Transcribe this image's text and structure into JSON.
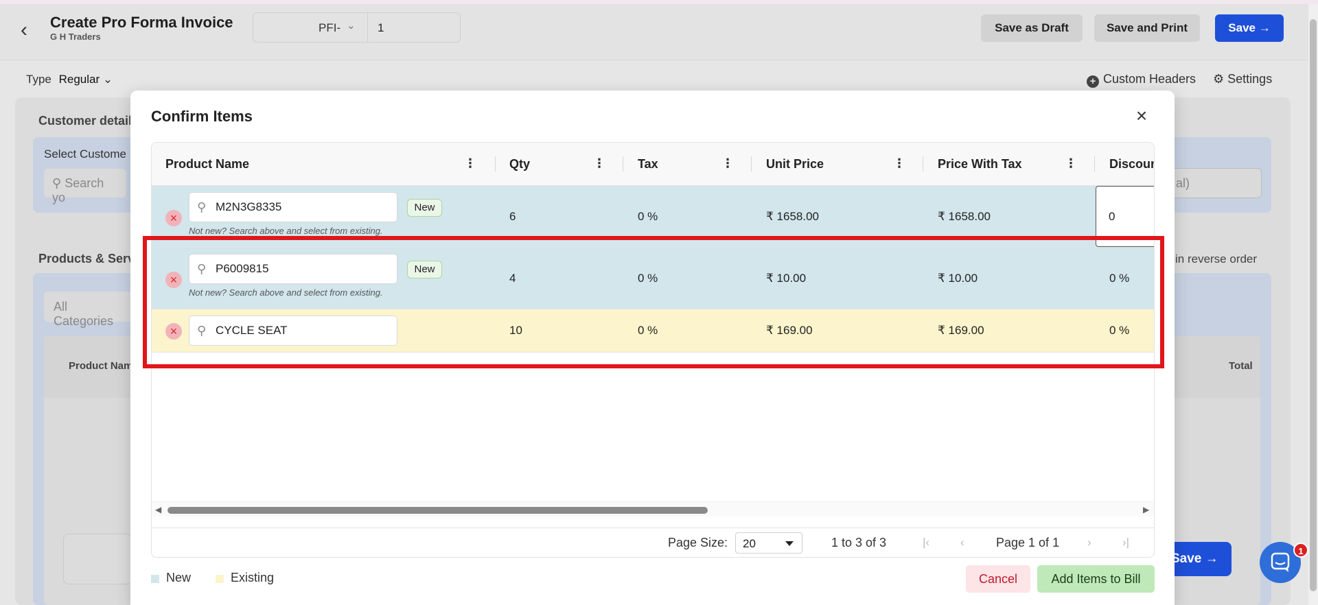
{
  "header": {
    "title": "Create Pro Forma Invoice",
    "subtitle": "G H Traders",
    "prefix": "PFI-",
    "number": "1",
    "save_draft": "Save as Draft",
    "save_print": "Save and Print",
    "save": "Save"
  },
  "toolbar": {
    "type_label": "Type",
    "type_value": "Regular",
    "custom_headers": "Custom Headers",
    "settings": "Settings"
  },
  "background": {
    "customer_details": "Customer detail",
    "select_customer": "Select Custome",
    "search_placeholder": "Search yo",
    "notes_placeholder": "al)",
    "products_services": "Products & Serv",
    "reverse_order": "in reverse order",
    "all_categories": "All Categories",
    "product_name_col": "Product Nam",
    "total_col": "Total",
    "save_bottom": "Save",
    "chat_badge": "1"
  },
  "modal": {
    "title": "Confirm Items",
    "columns": {
      "product_name": "Product Name",
      "qty": "Qty",
      "tax": "Tax",
      "unit_price": "Unit Price",
      "price_with_tax": "Price With Tax",
      "discount": "Discoun"
    },
    "rows": [
      {
        "name": "M2N3G8335",
        "badge": "New",
        "hint": "Not new? Search above and select from existing.",
        "qty": "6",
        "tax": "0 %",
        "unit_price": "₹ 1658.00",
        "price_with_tax": "₹ 1658.00",
        "discount": "0",
        "status": "new"
      },
      {
        "name": "P6009815",
        "badge": "New",
        "hint": "Not new? Search above and select from existing.",
        "qty": "4",
        "tax": "0 %",
        "unit_price": "₹ 10.00",
        "price_with_tax": "₹ 10.00",
        "discount": "0 %",
        "status": "new"
      },
      {
        "name": "CYCLE SEAT",
        "badge": "",
        "hint": "",
        "qty": "10",
        "tax": "0 %",
        "unit_price": "₹ 169.00",
        "price_with_tax": "₹ 169.00",
        "discount": "0 %",
        "status": "existing"
      }
    ],
    "pager": {
      "page_size_label": "Page Size:",
      "page_size_value": "20",
      "range": "1 to 3 of 3",
      "page_text": "Page 1 of 1"
    },
    "legend": {
      "new": "New",
      "existing": "Existing"
    },
    "cancel": "Cancel",
    "add_items": "Add Items to Bill"
  },
  "colors": {
    "new_row": "#d2e6ec",
    "existing_row": "#fcf4cc",
    "primary": "#1e4fd9",
    "highlight": "#e0161b"
  },
  "icons": [
    "back-arrow-icon",
    "chevron-down-icon",
    "arrow-right-icon",
    "plus-circle-icon",
    "gear-icon",
    "search-icon",
    "close-icon",
    "more-vertical-icon",
    "remove-icon",
    "first-page-icon",
    "prev-page-icon",
    "next-page-icon",
    "last-page-icon",
    "chat-icon"
  ]
}
